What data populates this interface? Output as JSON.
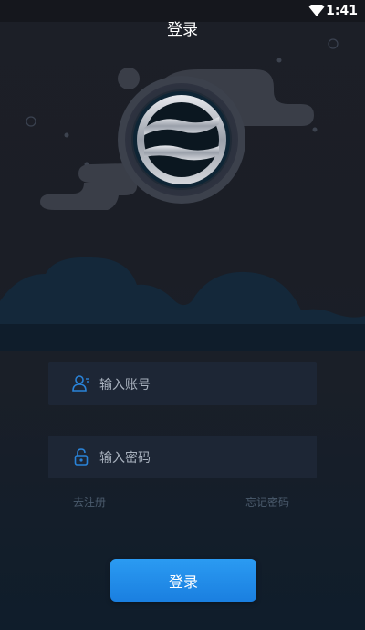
{
  "status_bar": {
    "time": "1:41",
    "wifi_icon": "wifi-icon"
  },
  "header": {
    "title": "登录"
  },
  "form": {
    "account": {
      "placeholder": "输入账号",
      "icon": "user-icon"
    },
    "password": {
      "placeholder": "输入密码",
      "icon": "lock-icon"
    }
  },
  "links": {
    "register": "去注册",
    "forgot_password": "忘记密码"
  },
  "login_button": {
    "label": "登录"
  },
  "colors": {
    "accent": "#1f8ceb",
    "background": "#1b1e26",
    "footer_bg": "#0f1d2b"
  }
}
